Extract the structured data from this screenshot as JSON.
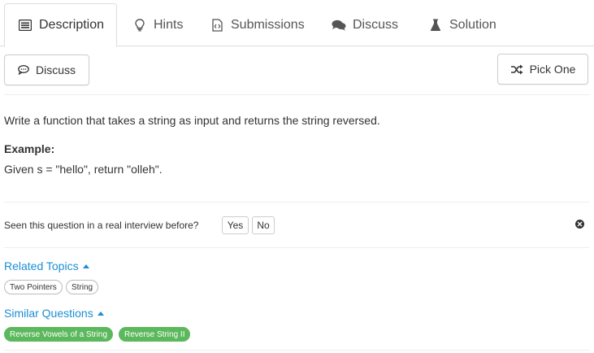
{
  "tabs": [
    {
      "label": "Description",
      "icon": "description-icon",
      "active": true
    },
    {
      "label": "Hints",
      "icon": "lightbulb-icon",
      "active": false
    },
    {
      "label": "Submissions",
      "icon": "code-file-icon",
      "active": false
    },
    {
      "label": "Discuss",
      "icon": "comments-icon",
      "active": false
    },
    {
      "label": "Solution",
      "icon": "flask-icon",
      "active": false
    }
  ],
  "toolbar": {
    "discuss_label": "Discuss",
    "pick_one_label": "Pick One"
  },
  "problem": {
    "statement": "Write a function that takes a string as input and returns the string reversed.",
    "example_heading": "Example:",
    "example_text": "Given s = \"hello\", return \"olleh\"."
  },
  "interview": {
    "question": "Seen this question in a real interview before?",
    "yes_label": "Yes",
    "no_label": "No"
  },
  "related_topics": {
    "heading": "Related Topics",
    "items": [
      "Two Pointers",
      "String"
    ]
  },
  "similar_questions": {
    "heading": "Similar Questions",
    "items": [
      "Reverse Vowels of a String",
      "Reverse String II"
    ]
  },
  "colors": {
    "link": "#1a8ed4",
    "similar_pill": "#5cb85c",
    "border": "#dddddd"
  }
}
